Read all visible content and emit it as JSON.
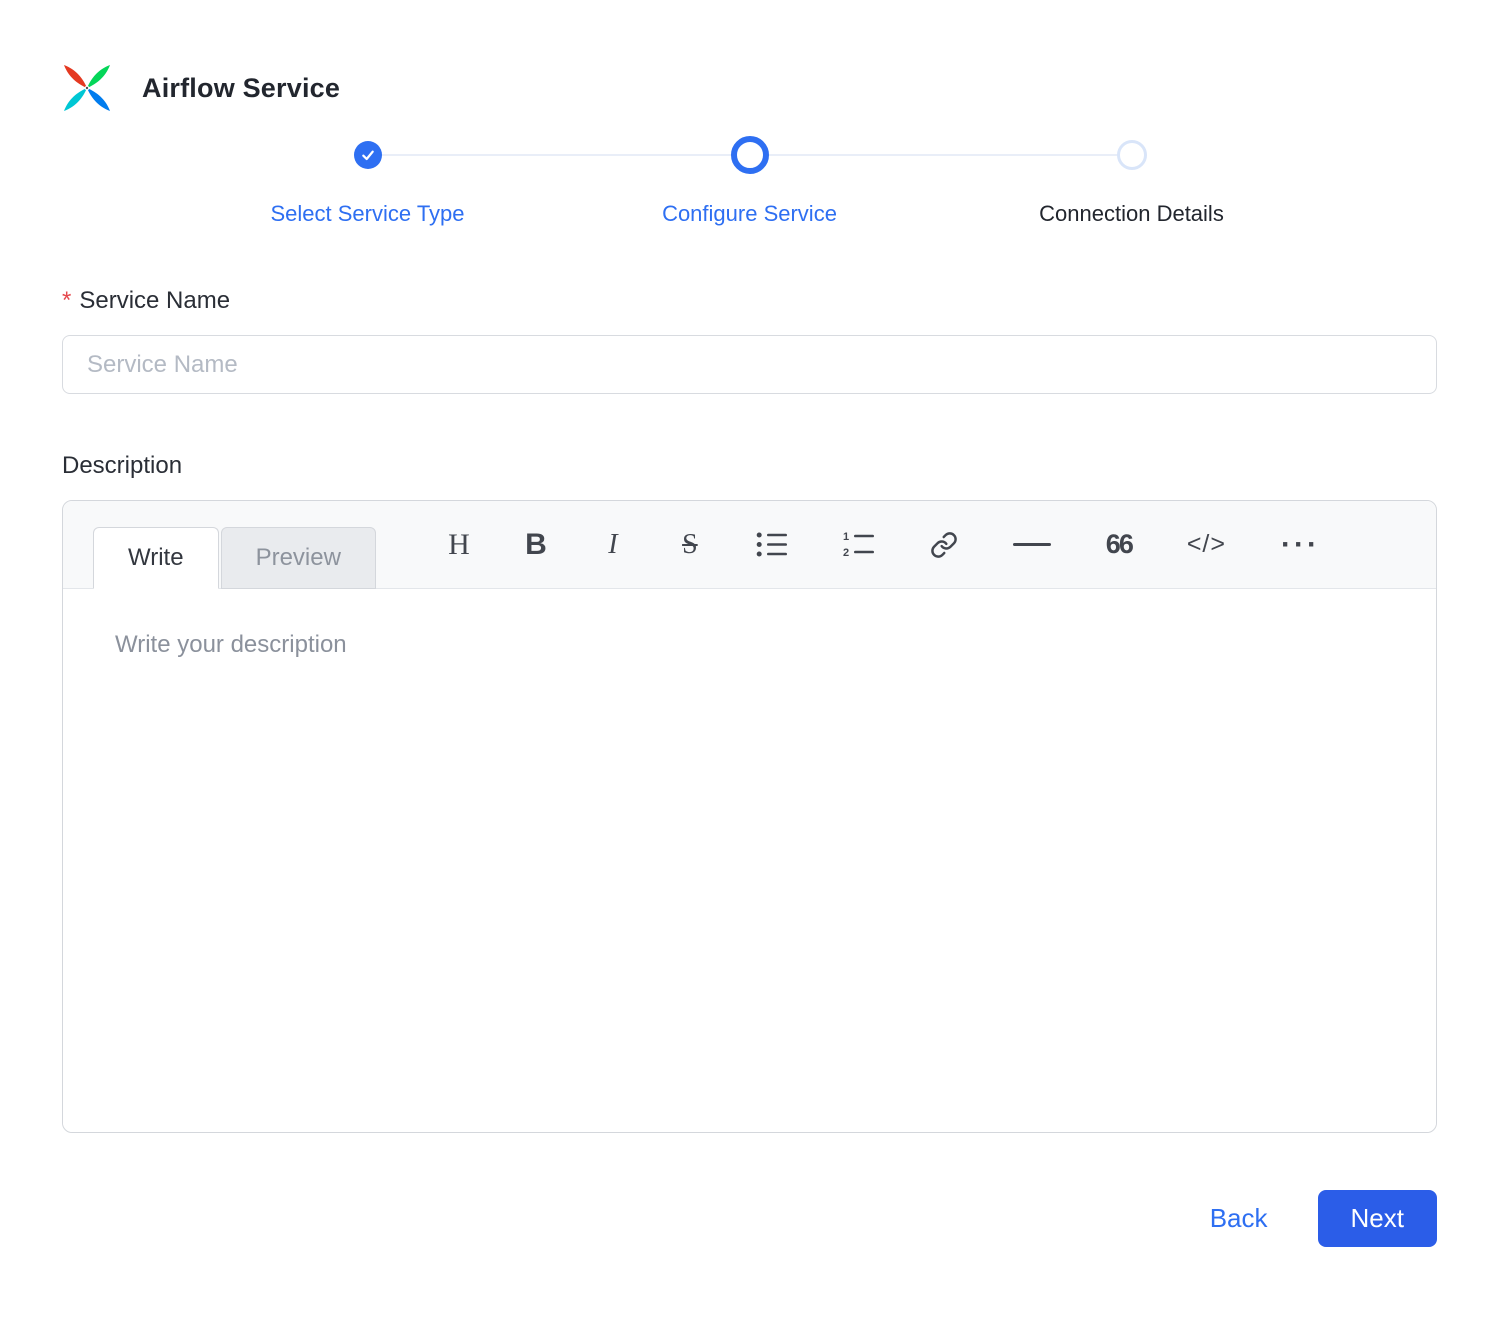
{
  "colors": {
    "accent": "#2e6ff2",
    "button": "#2b5de8",
    "required": "#e5484d",
    "upcoming_ring": "#d9e5f9"
  },
  "header": {
    "title": "Airflow Service"
  },
  "stepper": {
    "steps": [
      {
        "label": "Select Service Type",
        "state": "completed"
      },
      {
        "label": "Configure Service",
        "state": "active"
      },
      {
        "label": "Connection Details",
        "state": "upcoming"
      }
    ]
  },
  "form": {
    "service_name": {
      "required_marker": "*",
      "label": "Service Name",
      "placeholder": "Service Name",
      "value": ""
    },
    "description": {
      "label": "Description",
      "editor": {
        "tabs": [
          {
            "label": "Write",
            "active": true
          },
          {
            "label": "Preview",
            "active": false
          }
        ],
        "toolbar": [
          {
            "name": "heading",
            "glyph": "H"
          },
          {
            "name": "bold",
            "glyph": "B"
          },
          {
            "name": "italic",
            "glyph": "I"
          },
          {
            "name": "strikethrough",
            "glyph": "S"
          },
          {
            "name": "bulleted-list"
          },
          {
            "name": "numbered-list"
          },
          {
            "name": "link"
          },
          {
            "name": "horizontal-rule"
          },
          {
            "name": "quote",
            "glyph": "66"
          },
          {
            "name": "code",
            "glyph": "</>"
          },
          {
            "name": "more",
            "glyph": "···"
          }
        ],
        "placeholder": "Write your description",
        "value": ""
      }
    }
  },
  "footer": {
    "back_label": "Back",
    "next_label": "Next"
  }
}
